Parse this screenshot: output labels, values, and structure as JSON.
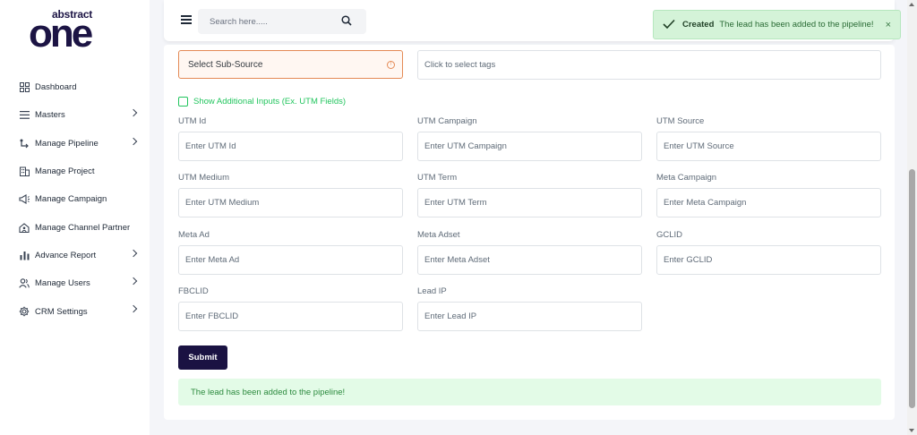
{
  "brand": {
    "logo_top": "abstract",
    "logo_main": "one"
  },
  "sidebar": {
    "items": [
      {
        "label": "Dashboard",
        "icon": "dashboard-icon",
        "has_submenu": false
      },
      {
        "label": "Masters",
        "icon": "list-icon",
        "has_submenu": true
      },
      {
        "label": "Manage Pipeline",
        "icon": "pipeline-icon",
        "has_submenu": true
      },
      {
        "label": "Manage Project",
        "icon": "building-icon",
        "has_submenu": false
      },
      {
        "label": "Manage Campaign",
        "icon": "megaphone-icon",
        "has_submenu": false
      },
      {
        "label": "Manage Channel Partner",
        "icon": "home-user-icon",
        "has_submenu": false
      },
      {
        "label": "Advance Report",
        "icon": "bar-chart-icon",
        "has_submenu": true
      },
      {
        "label": "Manage Users",
        "icon": "users-icon",
        "has_submenu": true
      },
      {
        "label": "CRM Settings",
        "icon": "gear-icon",
        "has_submenu": true
      }
    ]
  },
  "header": {
    "search_placeholder": "Search here....."
  },
  "toast": {
    "title": "Created",
    "message": "The lead has been added to the pipeline!",
    "close": "×"
  },
  "form": {
    "sub_source_placeholder": "Select Sub-Source",
    "tags_placeholder": "Click to select tags",
    "additional_inputs_label": "Show Additional Inputs (Ex. UTM Fields)",
    "fields": [
      {
        "label": "UTM Id",
        "placeholder": "Enter UTM Id"
      },
      {
        "label": "UTM Campaign",
        "placeholder": "Enter UTM Campaign"
      },
      {
        "label": "UTM Source",
        "placeholder": "Enter UTM Source"
      },
      {
        "label": "UTM Medium",
        "placeholder": "Enter UTM Medium"
      },
      {
        "label": "UTM Term",
        "placeholder": "Enter UTM Term"
      },
      {
        "label": "Meta Campaign",
        "placeholder": "Enter Meta Campaign"
      },
      {
        "label": "Meta Ad",
        "placeholder": "Enter Meta Ad"
      },
      {
        "label": "Meta Adset",
        "placeholder": "Enter Meta Adset"
      },
      {
        "label": "GCLID",
        "placeholder": "Enter GCLID"
      },
      {
        "label": "FBCLID",
        "placeholder": "Enter FBCLID"
      },
      {
        "label": "Lead IP",
        "placeholder": "Enter Lead IP"
      }
    ],
    "submit_label": "Submit",
    "success_message": "The lead has been added to the pipeline!"
  },
  "colors": {
    "brand_dark": "#1a1242",
    "success": "#22c55e",
    "warning_border": "#e48a55"
  }
}
